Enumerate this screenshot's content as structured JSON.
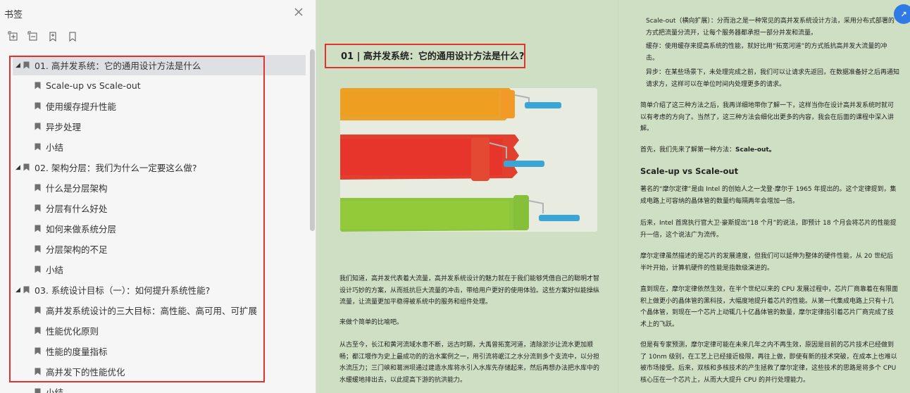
{
  "sidebar": {
    "title": "书签",
    "items": [
      {
        "level": 1,
        "label": "01. 高并发系统：它的通用设计方法是什么",
        "selected": true
      },
      {
        "level": 2,
        "label": "Scale-up vs Scale-out"
      },
      {
        "level": 2,
        "label": "使用缓存提升性能"
      },
      {
        "level": 2,
        "label": "异步处理"
      },
      {
        "level": 2,
        "label": "小结"
      },
      {
        "level": 1,
        "label": "02. 架构分层：我们为什么一定要这么做?"
      },
      {
        "level": 2,
        "label": "什么是分层架构"
      },
      {
        "level": 2,
        "label": "分层有什么好处"
      },
      {
        "level": 2,
        "label": "如何来做系统分层"
      },
      {
        "level": 2,
        "label": "分层架构的不足"
      },
      {
        "level": 2,
        "label": "小结"
      },
      {
        "level": 1,
        "label": "03. 系统设计目标（一）：如何提升系统性能?"
      },
      {
        "level": 2,
        "label": "高并发系统设计的三大目标：高性能、高可用、可扩展"
      },
      {
        "level": 2,
        "label": "性能优化原则"
      },
      {
        "level": 2,
        "label": "性能的度量指标"
      },
      {
        "level": 2,
        "label": "高并发下的性能优化"
      },
      {
        "level": 2,
        "label": "小结"
      }
    ]
  },
  "doc": {
    "left": {
      "title": "01 | 高并发系统：它的通用设计方法是什么?",
      "p1": "我们知道，高并发代表着大流量，高并发系统设计的魅力就在于我们能够凭借自己的聪明才智设计巧妙的方案，从而抵抗巨大流量的冲击，带给用户更好的使用体验。这些方案好似能操纵流量，让流量更加平稳得被系统中的服务和组件处理。",
      "p2": "来做个简单的比喻吧。",
      "p3": "从古至今，长江和黄河流域水患不断，远古时期，大禹曾拓宽河道，清除淤沙让流水更加顺畅；都江堰作为史上最成功的的治水案例之一，用引流将岷江之水分流到多个支流中，以分担水流压力；三门峡和葛洲坝通过建造水库将水引入水库先存储起来，然后再想办法把水库中的水缓缓地排出去，以此提高下游的抗洪能力。"
    },
    "right": {
      "b1": "Scale-out（横向扩展）：分而治之是一种常见的高并发系统设计方法，采用分布式部署的方式把流量分流开，让每个服务器都承担一部分并发和流量。",
      "b2": "缓存：使用缓存来提高系统的性能，就好比用“拓宽河道”的方式抵抗高并发大流量的冲击。",
      "b3": "异步：在某些场景下，未处理完成之前，我们可以让请求先返回，在数据准备好之后再通知请求方，这样可以在单位时间内处理更多的请求。",
      "p1": "简单介绍了这三种方法之后，我再详细地带你了解一下，这样当你在设计高并发系统时就可以有考虑的方向了。当然了，这三种方法会细化出更多的内容，我会在后面的课程中深入讲解。",
      "p2_pre": "首先，我们先来了解第一种方法：",
      "p2_bold": "Scale-out。",
      "h2": "Scale-up vs Scale-out",
      "p3": "著名的“摩尔定律”是由 Intel 的创始人之一戈登·摩尔于 1965 年提出的。这个定律提到，集成电路上可容纳的晶体管的数量约每隔两年会增加一倍。",
      "p4": "后来，Intel 首席执行官大卫·豪斯提出“18 个月”的说法，即预计 18 个月会将芯片的性能提升一倍，这个说法广为流传。",
      "p5": "摩尔定律虽然描述的是芯片的发展速度，但我们可以延伸为整体的硬件性能，从 20 世纪后半叶开始，计算机硬件的性能是指数级演进的。",
      "p6": "直到现在，摩尔定律依然生效，在半个世纪以来的 CPU 发展过程中，芯片厂商靠着在有限面积上做更小的晶体管的黑科技，大幅度地提升着芯片的性能。从第一代集成电路上只有十几个晶体管，到现在一个芯片上动辄几十亿晶体管的数量，摩尔定律指引着芯片厂商完成了技术上的飞跃。",
      "p7": "但是有专家预测，摩尔定律可能在未来几年之内不再生效，原因是目前的芯片技术已经做到了 10nm 级别，在工艺上已经接近极限，再往上做，即使有新的技术突破，在成本上也难以被市场接受。后来，双核和多核技术的产生拯救了摩尔定律，这些技术的思路是将多个 CPU 核心压在一个芯片上，从而大大提升 CPU 的并行处理能力。"
    },
    "float_button": "↗"
  }
}
